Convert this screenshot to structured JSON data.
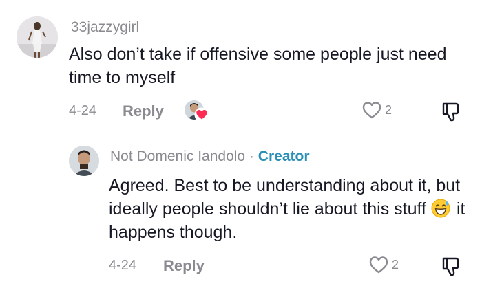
{
  "comments": [
    {
      "username": "33jazzygirl",
      "text": "Also don’t take if offensive some people just need time to myself",
      "date": "4-24",
      "reply_label": "Reply",
      "like_count": "2"
    },
    {
      "username": "Not Domenic Iandolo",
      "separator": "·",
      "badge": "Creator",
      "text_before_emoji": "Agreed. Best to be understanding about it, but ideally people shouldn’t lie about this stuff",
      "text_after_emoji": "it happens though.",
      "emoji": "grinning-sweat-emoji",
      "date": "4-24",
      "reply_label": "Reply",
      "like_count": "2"
    }
  ],
  "colors": {
    "text_primary": "#161823",
    "text_secondary": "#8a8b91",
    "creator_badge": "#2b8fb6",
    "heart": "#fe2c55"
  },
  "icons": [
    "avatar",
    "liked-by-creator-avatar",
    "heart-icon",
    "like-icon",
    "dislike-icon",
    "grinning-sweat-emoji"
  ]
}
